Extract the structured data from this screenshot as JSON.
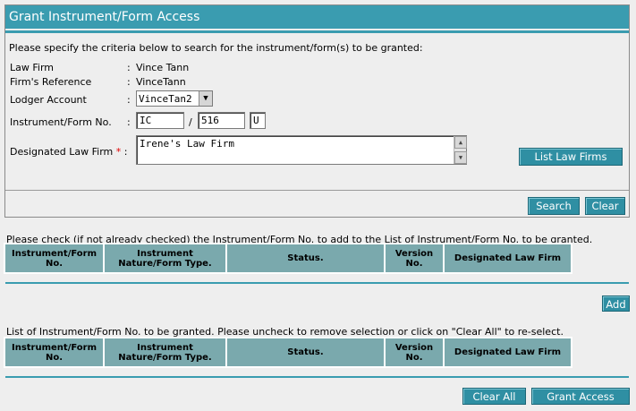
{
  "page": {
    "title": "Grant Instrument/Form Access",
    "instruction": "Please specify the criteria below to search for the instrument/form(s) to be granted:"
  },
  "criteria": {
    "law_firm_label": "Law Firm",
    "law_firm_value": "Vince Tann",
    "firms_reference_label": "Firm's Reference",
    "firms_reference_value": "VinceTann",
    "lodger_account_label": "Lodger Account",
    "lodger_account_value": "VinceTan2",
    "instrument_no_label": "Instrument/Form No.",
    "instrument_prefix": "IC",
    "instrument_separator": "/",
    "instrument_number": "516",
    "instrument_suffix": "U",
    "designated_law_firm_label": "Designated Law Firm",
    "required_marker": "*",
    "designated_law_firm_value": "Irene's Law Firm",
    "separator_colon": ":"
  },
  "buttons": {
    "list_law_firms": "List Law Firms",
    "search": "Search",
    "clear": "Clear",
    "add": "Add",
    "clear_all": "Clear All",
    "grant_access": "Grant Access"
  },
  "search_results": {
    "instruction": "Please check (if not already checked) the Instrument/Form No. to add to the List of Instrument/Form No. to be granted.",
    "columns": [
      {
        "line1": "Instrument/Form",
        "line2": "No."
      },
      {
        "line1": "Instrument",
        "line2": "Nature/Form Type."
      },
      {
        "line1": "Status.",
        "line2": ""
      },
      {
        "line1": "Version",
        "line2": "No."
      },
      {
        "line1": "Designated Law Firm",
        "line2": ""
      }
    ]
  },
  "granted_list": {
    "instruction": "List of Instrument/Form No. to be granted. Please uncheck to remove selection or click on \"Clear All\" to re-select.",
    "columns": [
      {
        "line1": "Instrument/Form",
        "line2": "No."
      },
      {
        "line1": "Instrument",
        "line2": "Nature/Form Type."
      },
      {
        "line1": "Status.",
        "line2": ""
      },
      {
        "line1": "Version",
        "line2": "No."
      },
      {
        "line1": "Designated Law Firm",
        "line2": ""
      }
    ]
  },
  "colors": {
    "accent": "#3a9cb0",
    "button": "#2f8fa3",
    "table_header": "#7aa9ad",
    "required": "#e00000"
  }
}
